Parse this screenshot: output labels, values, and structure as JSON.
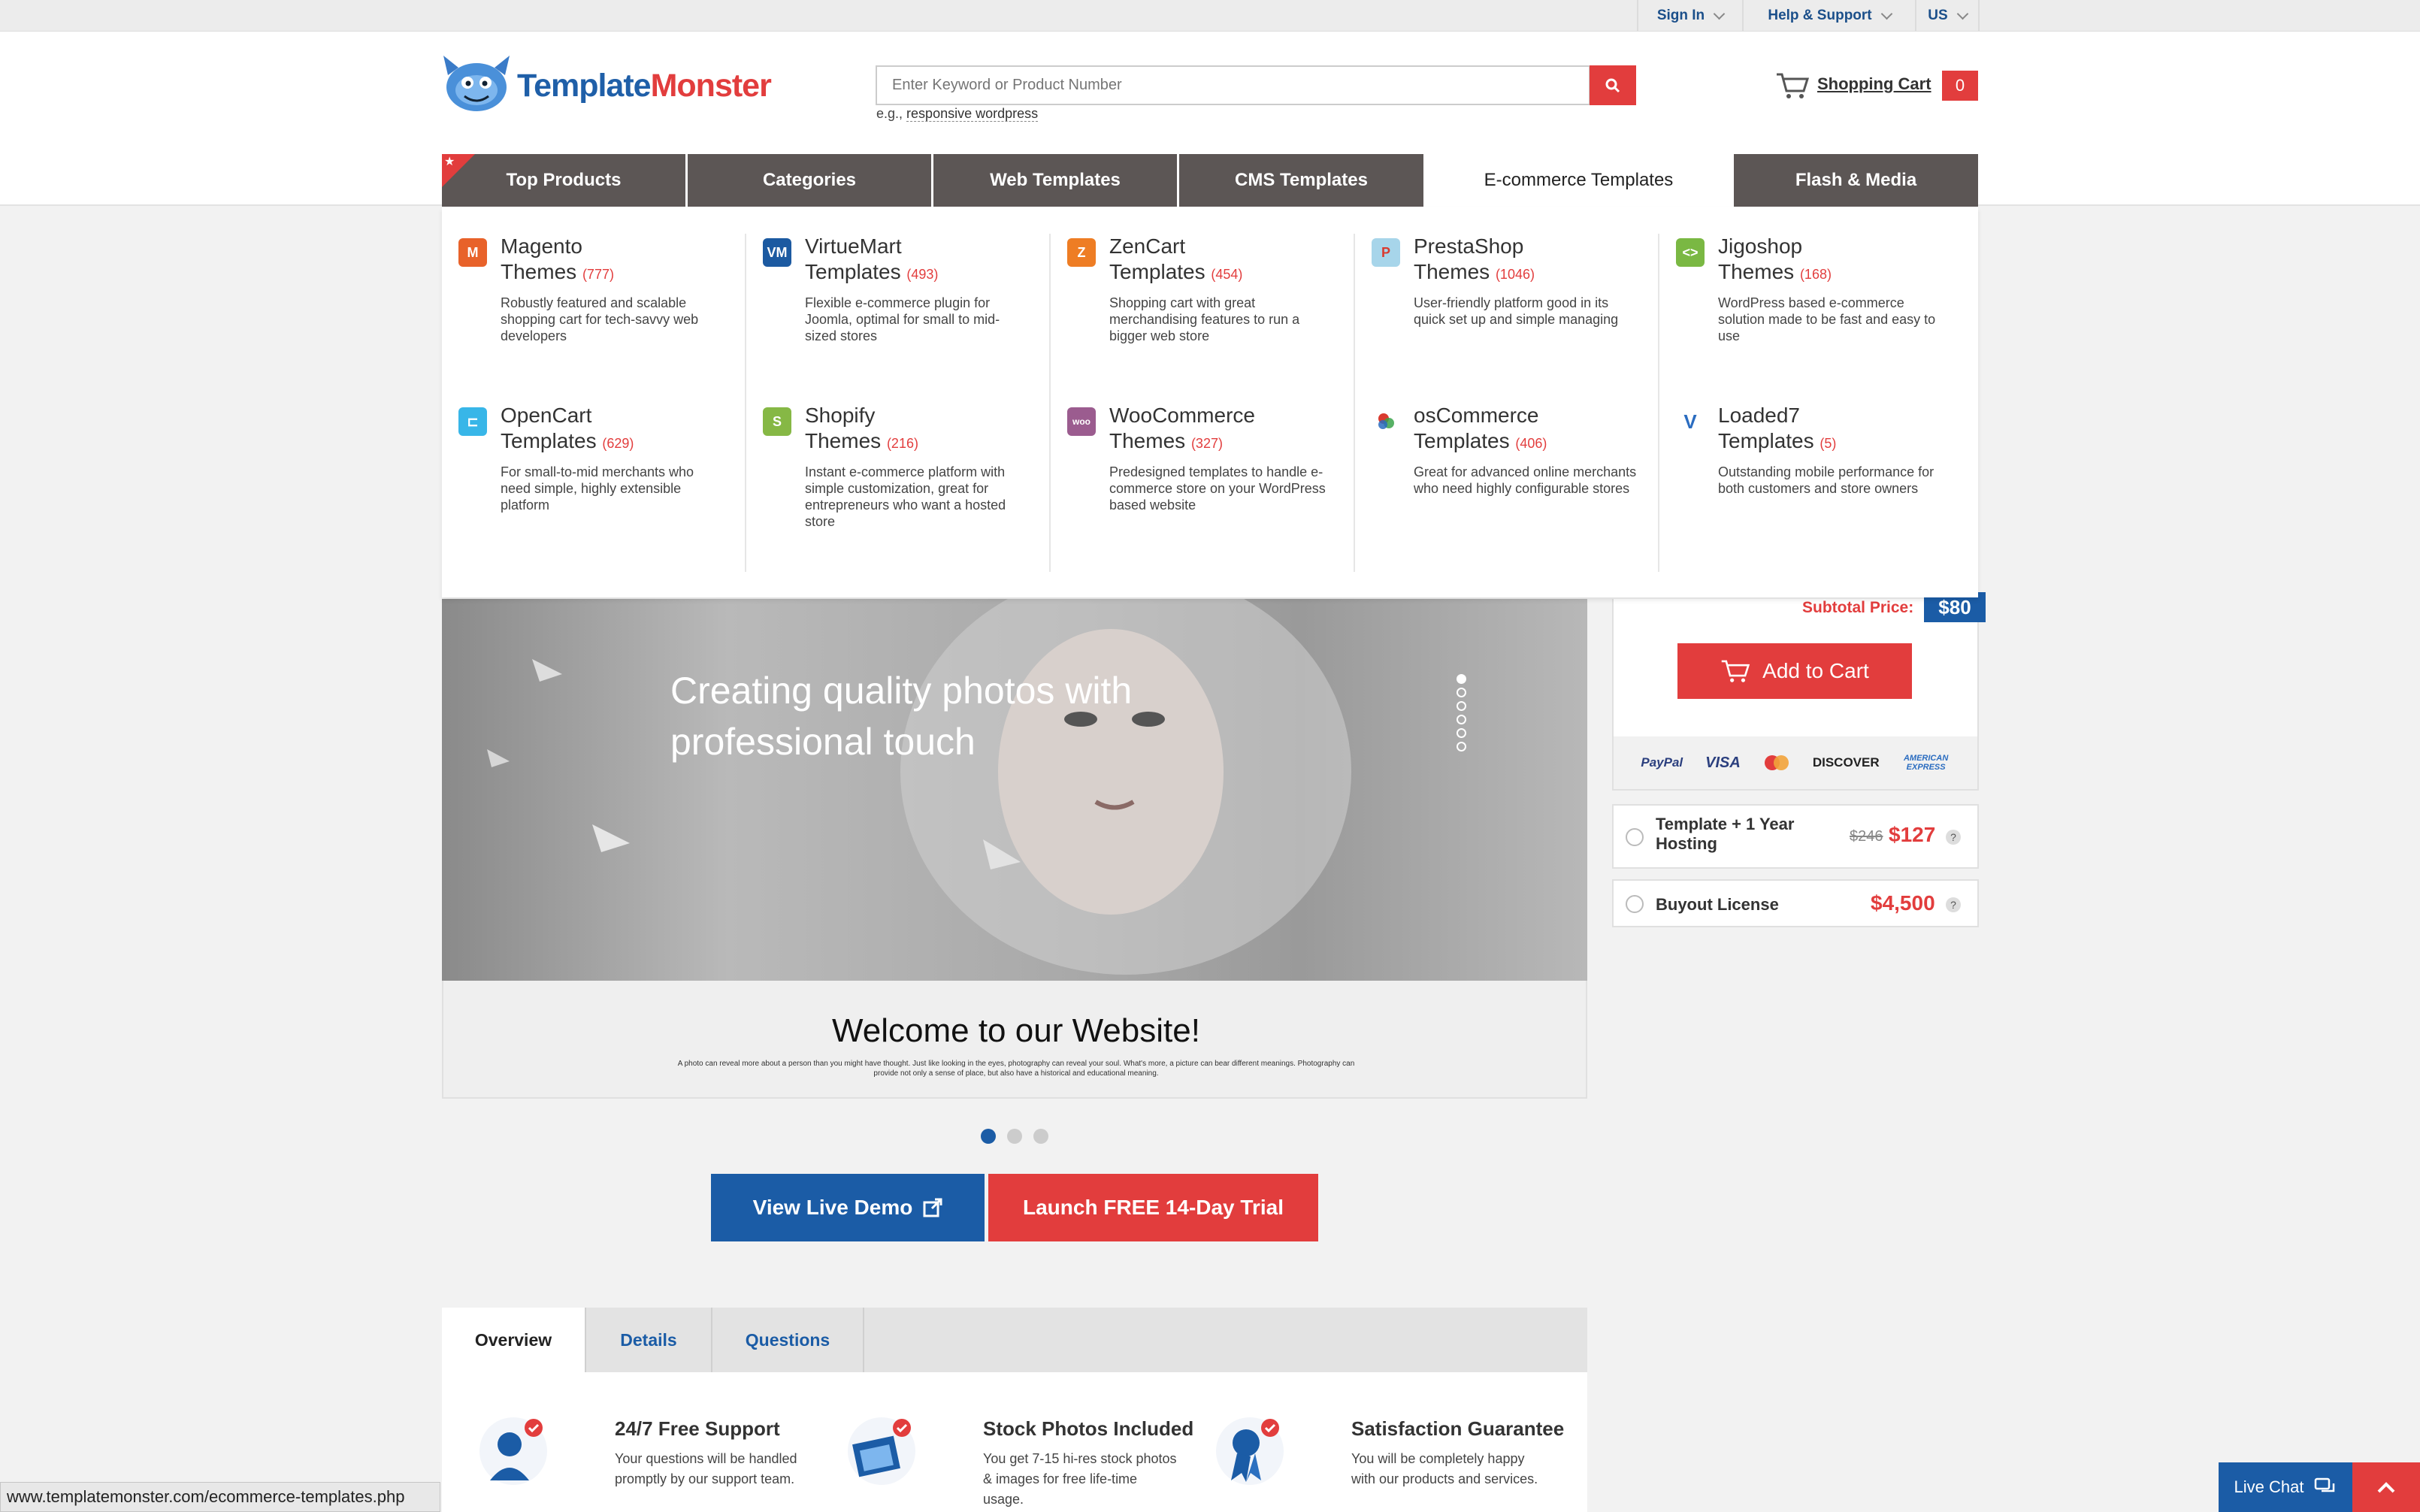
{
  "topbar": {
    "sign_in": "Sign In",
    "help": "Help & Support",
    "region": "US"
  },
  "logo": {
    "part1": "Template",
    "part2": "Monster"
  },
  "search": {
    "placeholder": "Enter Keyword or Product Number",
    "hint_prefix": "e.g.,",
    "hint_link": "responsive wordpress"
  },
  "cart": {
    "label": "Shopping Cart",
    "count": "0"
  },
  "nav": {
    "tabs": [
      {
        "label": "Top Products"
      },
      {
        "label": "Categories"
      },
      {
        "label": "Web Templates"
      },
      {
        "label": "CMS Templates"
      },
      {
        "label": "E-commerce Templates"
      },
      {
        "label": "Flash & Media"
      }
    ]
  },
  "mega": {
    "items": [
      {
        "title1": "Magento",
        "title2": "Themes",
        "count": "(777)",
        "desc": "Robustly featured and scalable shopping cart for tech-savvy web developers",
        "icon": "magento-icon",
        "color": "#e8622a"
      },
      {
        "title1": "VirtueMart",
        "title2": "Templates",
        "count": "(493)",
        "desc": "Flexible e-commerce plugin for Joomla, optimal for small to mid-sized stores",
        "icon": "virtuemart-icon",
        "color": "#1c5aa1"
      },
      {
        "title1": "ZenCart",
        "title2": "Templates",
        "count": "(454)",
        "desc": "Shopping cart with great merchandising features to run a bigger web store",
        "icon": "zencart-icon",
        "color": "#ee7d24"
      },
      {
        "title1": "PrestaShop",
        "title2": "Themes",
        "count": "(1046)",
        "desc": "User-friendly platform good in its quick set up and simple managing",
        "icon": "prestashop-icon",
        "color": "#a7d5ea"
      },
      {
        "title1": "Jigoshop",
        "title2": "Themes",
        "count": "(168)",
        "desc": "WordPress based e-commerce solution made to be fast and easy to use",
        "icon": "jigoshop-icon",
        "color": "#7ab843"
      },
      {
        "title1": "OpenCart",
        "title2": "Templates",
        "count": "(629)",
        "desc": "For small-to-mid merchants who need simple, highly extensible platform",
        "icon": "opencart-icon",
        "color": "#38b6e8"
      },
      {
        "title1": "Shopify",
        "title2": "Themes",
        "count": "(216)",
        "desc": "Instant e-commerce platform with simple customization, great for entrepreneurs who want a hosted store",
        "icon": "shopify-icon",
        "color": "#86b845"
      },
      {
        "title1": "WooCommerce",
        "title2": "Themes",
        "count": "(327)",
        "desc": "Predesigned templates to handle e-commerce store on your WordPress based website",
        "icon": "woocommerce-icon",
        "color": "#9b5c8f"
      },
      {
        "title1": "osCommerce",
        "title2": "Templates",
        "count": "(406)",
        "desc": "Great for advanced online merchants who need highly configurable stores",
        "icon": "oscommerce-icon",
        "color": "#d93a2f"
      },
      {
        "title1": "Loaded7",
        "title2": "Templates",
        "count": "(5)",
        "desc": "Outstanding mobile performance for both customers and store owners",
        "icon": "loaded7-icon",
        "color": "#2a6cc0"
      }
    ]
  },
  "hero": {
    "title": "Creating quality photos with professional touch",
    "welcome_title": "Welcome to our Website!",
    "welcome_text": "A photo can reveal more about a person than you might have thought. Just like looking in the eyes, photography can reveal your soul. What's more, a picture can bear different meanings. Photography can provide not only a sense of place, but also have a historical and educational meaning."
  },
  "cta": {
    "demo": "View Live Demo",
    "trial": "Launch FREE 14-Day Trial"
  },
  "tabs": [
    {
      "label": "Overview"
    },
    {
      "label": "Details"
    },
    {
      "label": "Questions"
    }
  ],
  "features": [
    {
      "title": "24/7 Free Support",
      "text": "Your questions will be handled promptly by our support team."
    },
    {
      "title": "Stock Photos Included",
      "text": "You get 7-15 hi-res stock photos & images for free life-time usage."
    },
    {
      "title": "Satisfaction Guarantee",
      "text": "You will be completely happy with our products and services."
    }
  ],
  "sidebar": {
    "subtotal_label": "Subtotal Price:",
    "subtotal_value": "$80",
    "add_to_cart": "Add to Cart",
    "payments": [
      "PayPal",
      "VISA",
      "DISCOVER",
      "AMERICAN EXPRESS"
    ],
    "options": [
      {
        "label": "Template + 1 Year Hosting",
        "old": "$246",
        "price": "$127"
      },
      {
        "label": "Buyout License",
        "price": "$4,500"
      }
    ]
  },
  "status": {
    "url": "www.templatemonster.com/ecommerce-templates.php"
  },
  "chat": {
    "label": "Live Chat"
  },
  "colors": {
    "brand_blue": "#1b5ca6",
    "brand_red": "#e23d3d",
    "nav_dark": "#5c5655"
  }
}
